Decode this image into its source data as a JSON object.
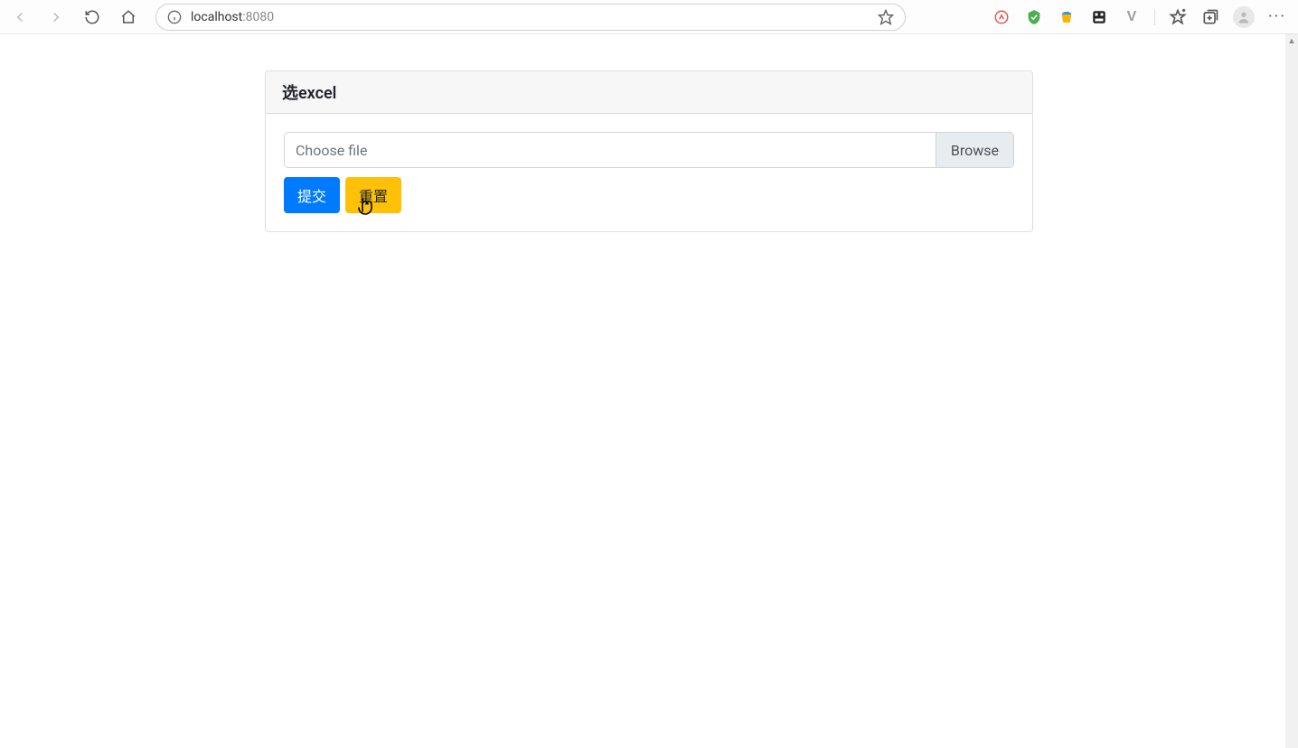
{
  "browser": {
    "url_host": "localhost",
    "url_port": ":8080",
    "icons": {
      "back": "back-icon",
      "forward": "forward-icon",
      "reload": "reload-icon",
      "home": "home-icon",
      "info": "info-icon",
      "favorite": "favorite-icon",
      "collections": "collections-icon",
      "profile": "profile-icon",
      "more": "more-icon"
    },
    "extensions": [
      {
        "name": "compass-extension-icon",
        "glyph": "🧭"
      },
      {
        "name": "shield-extension-icon",
        "glyph": "▼",
        "color": "#4caf50"
      },
      {
        "name": "bucket-extension-icon",
        "glyph": "🪣"
      },
      {
        "name": "matrix-extension-icon",
        "glyph": "▦",
        "color": "#222"
      },
      {
        "name": "vue-extension-icon",
        "glyph": "V",
        "color": "#9e9e9e"
      }
    ]
  },
  "card": {
    "title": "选excel",
    "file_placeholder": "Choose file",
    "browse_label": "Browse",
    "submit_label": "提交",
    "reset_label": "重置"
  },
  "colors": {
    "primary": "#007bff",
    "warning": "#ffc107",
    "border": "#ced4da",
    "header_bg": "#f7f7f7"
  }
}
